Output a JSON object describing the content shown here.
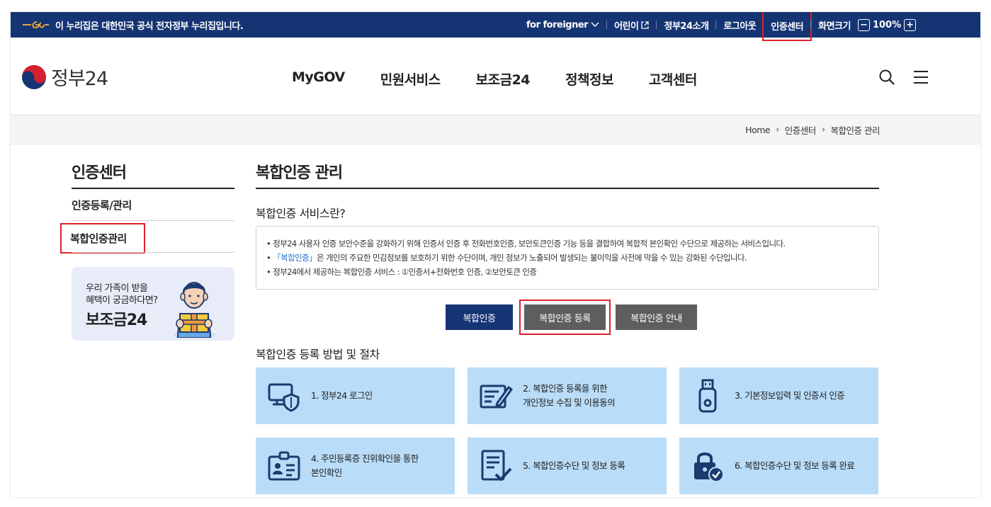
{
  "topbar": {
    "gov_notice": "이 누리집은 대한민국 공식 전자정부 누리집입니다.",
    "links": {
      "foreigner": "for foreigner",
      "kids": "어린이",
      "about": "정부24소개",
      "logout": "로그아웃",
      "cert_center": "인증센터",
      "screen_size": "화면크기",
      "zoom_value": "100%"
    }
  },
  "header": {
    "logo_text": "정부24",
    "nav": [
      "MyGOV",
      "민원서비스",
      "보조금24",
      "정책정보",
      "고객센터"
    ]
  },
  "breadcrumb": [
    "Home",
    "인증센터",
    "복합인증 관리"
  ],
  "sidebar": {
    "title": "인증센터",
    "items": [
      "인증등록/관리",
      "복합인증관리"
    ],
    "banner": {
      "line1": "우리 가족이 받을",
      "line2": "혜택이 궁금하다면?",
      "big": "보조금24"
    }
  },
  "main": {
    "title": "복합인증 관리",
    "intro_heading": "복합인증 서비스란?",
    "info": {
      "line1": "정부24 사용자 인증 보안수준을 강화하기 위해 인증서 인증 후 전화번호인증, 보안토큰인증 기능 등을 결합하여 복합적 본인확인 수단으로 제공하는 서비스입니다.",
      "line2_highlight": "「복합인증」",
      "line2_rest": "은 개인의 주요한 민감정보를 보호하기 위한 수단이며, 개인 정보가 노출되어 발생되는 불이익을 사전에 막을 수 있는 강화된 수단입니다.",
      "line3": "정부24에서 제공하는 복합인증 서비스 : ①인증서+전화번호 인증, ②보안토큰 인증"
    },
    "tabs": [
      "복합인증",
      "복합인증 등록",
      "복합인증 안내"
    ],
    "steps_heading": "복합인증 등록 방법 및 절차",
    "steps": [
      {
        "line1": "1. 정부24 로그인",
        "line2": ""
      },
      {
        "line1": "2. 복합인증 등록을 위한",
        "line2": "개인정보 수집 및 이용동의"
      },
      {
        "line1": "3. 기본정보입력 및 인증서 인증",
        "line2": ""
      },
      {
        "line1": "4. 주민등록증 진위확인을 통한",
        "line2": "본인확인"
      },
      {
        "line1": "5. 복합인증수단 및 정보 등록",
        "line2": ""
      },
      {
        "line1": "6. 복합인증수단 및 정보 등록 완료",
        "line2": ""
      }
    ]
  },
  "colors": {
    "topbar_bg": "#153473",
    "highlight_box": "#e0202a",
    "card_bg": "#b9dcf8",
    "tab_active": "#153473",
    "tab_inactive": "#5e5e5e",
    "info_highlight": "#1f6fd1"
  },
  "icons": [
    "gov-wing-icon",
    "chevron-down-icon",
    "external-link-icon",
    "minus-icon",
    "plus-icon",
    "taegeuk-logo-icon",
    "search-icon",
    "menu-icon",
    "computer-shield-icon",
    "form-pen-icon",
    "usb-token-icon",
    "id-card-icon",
    "document-check-icon",
    "lock-check-icon"
  ]
}
